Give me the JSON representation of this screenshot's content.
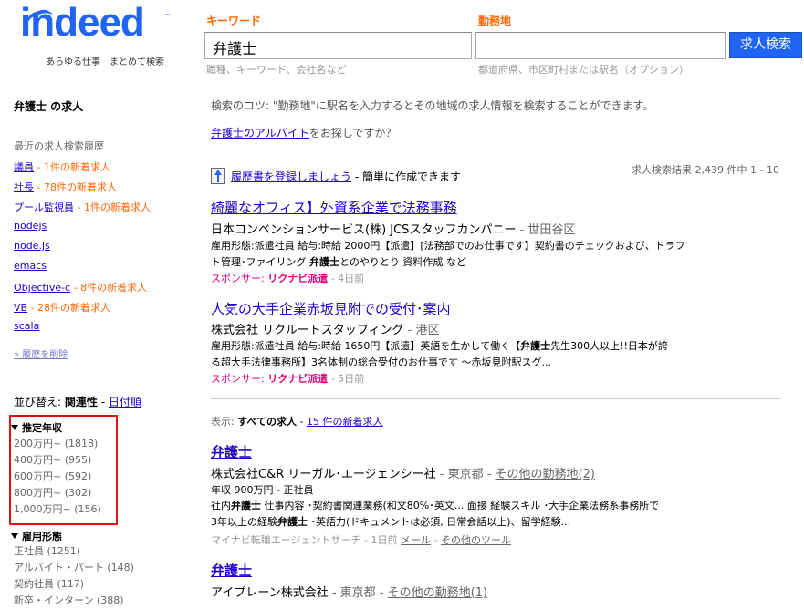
{
  "logo": {
    "text": "indeed",
    "tm": "™",
    "tagline": "あらゆる仕事　まとめて検索"
  },
  "search": {
    "keyword_label": "キーワード",
    "keyword_value": "弁護士",
    "keyword_hint": "職種、キーワード、会社名など",
    "location_label": "勤務地",
    "location_value": "",
    "location_hint": "都道府県、市区町村または駅名（オプション）",
    "button_label": "求人検索"
  },
  "sidebar": {
    "title": "弁護士 の求人",
    "history_title": "最近の求人検索履歴",
    "history": [
      {
        "term": "議員",
        "new": " - 1件の新着求人"
      },
      {
        "term": "社長",
        "new": " - 78件の新着求人"
      },
      {
        "term": "プール監視員",
        "new": " - 1件の新着求人"
      },
      {
        "term": "nodejs",
        "new": ""
      },
      {
        "term": "node.js",
        "new": ""
      },
      {
        "term": "emacs",
        "new": ""
      },
      {
        "term": "Objective-c",
        "new": " - 8件の新着求人"
      },
      {
        "term": "VB",
        "new": " - 28件の新着求人"
      },
      {
        "term": "scala",
        "new": ""
      }
    ],
    "clear_history": "» 履歴を削除",
    "sort_label": "並び替え: ",
    "sort_current": "関連性",
    "sort_sep": " - ",
    "sort_alt": "日付順",
    "salary_title": "推定年収",
    "salary_items": [
      "200万円~ (1818)",
      "400万円~ (955)",
      "600万円~ (592)",
      "800万円~ (302)",
      "1,000万円~ (156)"
    ],
    "jobtype_title": "雇用形態",
    "jobtype_items": [
      "正社員 (1251)",
      "アルバイト・パート (148)",
      "契約社員 (117)",
      "新卒・インターン (388)"
    ]
  },
  "main": {
    "tip": "検索のコツ: \"勤務地\"に駅名を入力するとその地域の求人情報を検索することができます。",
    "suggest_link": "弁護士のアルバイト",
    "suggest_text": "をお探しですか？",
    "resume_link": "履歴書を登録しましょう",
    "resume_text": " - 簡単に作成できます",
    "results_count": "求人検索結果 2,439 件中 1 - 10",
    "show_label": "表示: ",
    "show_all": "すべての求人",
    "show_sep": " - ",
    "show_new": "15 件の新着求人",
    "sponsored": [
      {
        "title": "綺麗なオフィス】外資系企業で法務事務",
        "company": "日本コンベンションサービス(株) JCSスタッフカンパニー",
        "location": " - 世田谷区",
        "snippet1": "雇用形態:派遣社員 給与:時給 2000円【派遣】[法務部でのお仕事です】契約書のチェックおよび、ドラフ",
        "snippet2a": "ト管理･ファイリング ",
        "snippet2b": "弁護士",
        "snippet2c": "とのやりとり 資料作成 など",
        "sponsor": "スポンサー: ",
        "sponsor_name": "リクナビ派遣",
        "ago": " - 4日前"
      },
      {
        "title": "人気の大手企業赤坂見附での受付･案内",
        "company": "株式会社 リクルートスタッフィング",
        "location": " - 港区",
        "snippet1a": "雇用形態:派遣社員 給与:時給 1650円【派遣】英語を生かして働く【",
        "snippet1b": "弁護士",
        "snippet1c": "先生300人以上!!日本が誇",
        "snippet2": "る超大手法律事務所】3名体制の総合受付のお仕事です 〜赤坂見附駅スグ...",
        "sponsor": "スポンサー: ",
        "sponsor_name": "リクナビ派遣",
        "ago": " - 5日前"
      }
    ],
    "organic": [
      {
        "title": "弁護士",
        "company": "株式会社C&R リーガル･エージェンシー社",
        "location": " - 東京都 - ",
        "other_locations": "その他の勤務地(2)",
        "salary": "年収 900万円 - 正社員",
        "snippet1a": "社内",
        "snippet1b": "弁護士",
        "snippet1c": " 仕事内容 ･契約書関連業務(和文80%･英文... 面接 経験スキル ･大手企業法務系事務所で",
        "snippet2a": "3年以上の経験",
        "snippet2b": "弁護士",
        "snippet2c": " ･英語力(ドキュメントは必須, 日常会話以上)、留学経験...",
        "source": "マイナビ転職エージェントサーチ - 1日前 ",
        "mail": "メール",
        "tools_sep": " - ",
        "tools": "その他のツール"
      },
      {
        "title": "弁護士",
        "company": "アイプレーン株式会社",
        "location": " - 東京都 - ",
        "other_locations": "その他の勤務地(1)"
      }
    ]
  },
  "colors": {
    "accent": "#2164f3",
    "link": "#2200cc",
    "orange": "#ff6600",
    "sponsor": "#e2007a",
    "highlight_box": "#e01010"
  }
}
